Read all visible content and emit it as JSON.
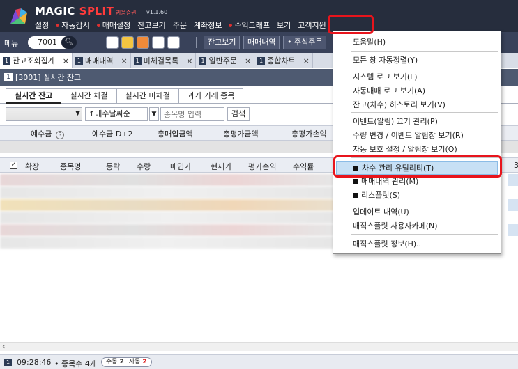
{
  "app": {
    "name_main": "MAGIC",
    "name_accent": "SPLIT",
    "broker": "키움증권",
    "version": "v1.1.60"
  },
  "menubar": [
    {
      "label": "설정",
      "dot": false
    },
    {
      "label": "자동감시",
      "dot": true
    },
    {
      "label": "매매설정",
      "dot": true
    },
    {
      "label": "잔고보기",
      "dot": false
    },
    {
      "label": "주문",
      "dot": false
    },
    {
      "label": "계좌정보",
      "dot": false
    },
    {
      "label": "수익그래프",
      "dot": true
    },
    {
      "label": "보기",
      "dot": false
    },
    {
      "label": "고객지원",
      "dot": false
    }
  ],
  "toolbar": {
    "menu_label": "메뉴",
    "menu_code": "7001",
    "search_icon": "search-icon",
    "buttons": [
      "잔고보기",
      "매매내역",
      "• 주식주문"
    ]
  },
  "doc_tabs": [
    {
      "num": "1",
      "label": "잔고조회집계",
      "active": true
    },
    {
      "num": "1",
      "label": "매매내역",
      "active": false
    },
    {
      "num": "1",
      "label": "미체결목록",
      "active": false
    },
    {
      "num": "1",
      "label": "일반주문",
      "active": false
    },
    {
      "num": "1",
      "label": "종합차트",
      "active": false
    }
  ],
  "window": {
    "num": "1",
    "title": "[3001] 실시간 잔고"
  },
  "sub_tabs": [
    {
      "label": "실시간 잔고",
      "active": true
    },
    {
      "label": "실시간 체결",
      "active": false
    },
    {
      "label": "실시간 미체결",
      "active": false
    },
    {
      "label": "과거 거래 종목",
      "active": false
    }
  ],
  "filters": {
    "sort_value": "↑매수날짜순",
    "stock_placeholder": "종목명 입력",
    "search_label": "검색"
  },
  "summary_columns": [
    "예수금",
    "예수금 D+2",
    "총매입금액",
    "총평가금액",
    "총평가손익"
  ],
  "grid_columns": [
    "확장",
    "종목명",
    "등락",
    "수량",
    "매입가",
    "현재가",
    "평가손익",
    "수익률"
  ],
  "grid_extra_label": "3",
  "status": {
    "num": "1",
    "time": "09:28:46",
    "count": "• 종목수 4개",
    "manual_label": "수동",
    "manual_count": "2",
    "auto_label": "자동",
    "auto_count": "2"
  },
  "dropdown": {
    "items": [
      {
        "label": "도움말(H)",
        "bullet": false,
        "highlighted": false
      },
      {
        "label": "모든 창 자동정렬(Y)",
        "bullet": false,
        "highlighted": false
      },
      {
        "label": "시스템 로그 보기(L)",
        "bullet": false,
        "highlighted": false
      },
      {
        "label": "자동매매 로그 보기(A)",
        "bullet": false,
        "highlighted": false
      },
      {
        "label": "잔고(차수) 히스토리 보기(V)",
        "bullet": false,
        "highlighted": false
      },
      {
        "label": "이벤트(알림) 끄기 관리(P)",
        "bullet": false,
        "highlighted": false
      },
      {
        "label": "수량 변경 / 이벤트 알림창 보기(R)",
        "bullet": false,
        "highlighted": false
      },
      {
        "label": "자동 보호 설정 / 알림창 보기(O)",
        "bullet": false,
        "highlighted": false
      },
      {
        "label": "차수 관리 유틸리티(T)",
        "bullet": true,
        "highlighted": true
      },
      {
        "label": "매매내역 관리(M)",
        "bullet": true,
        "highlighted": false
      },
      {
        "label": "리스플릿(S)",
        "bullet": true,
        "highlighted": false
      },
      {
        "label": "업데이트 내역(U)",
        "bullet": false,
        "highlighted": false
      },
      {
        "label": "매직스플릿 사용자카페(N)",
        "bullet": false,
        "highlighted": false
      },
      {
        "label": "매직스플릿 정보(H)..",
        "bullet": false,
        "highlighted": false
      }
    ]
  },
  "colors": {
    "titlebar": "#262d3d",
    "accent_red": "#e8141c",
    "highlight": "#c7e0f5"
  }
}
